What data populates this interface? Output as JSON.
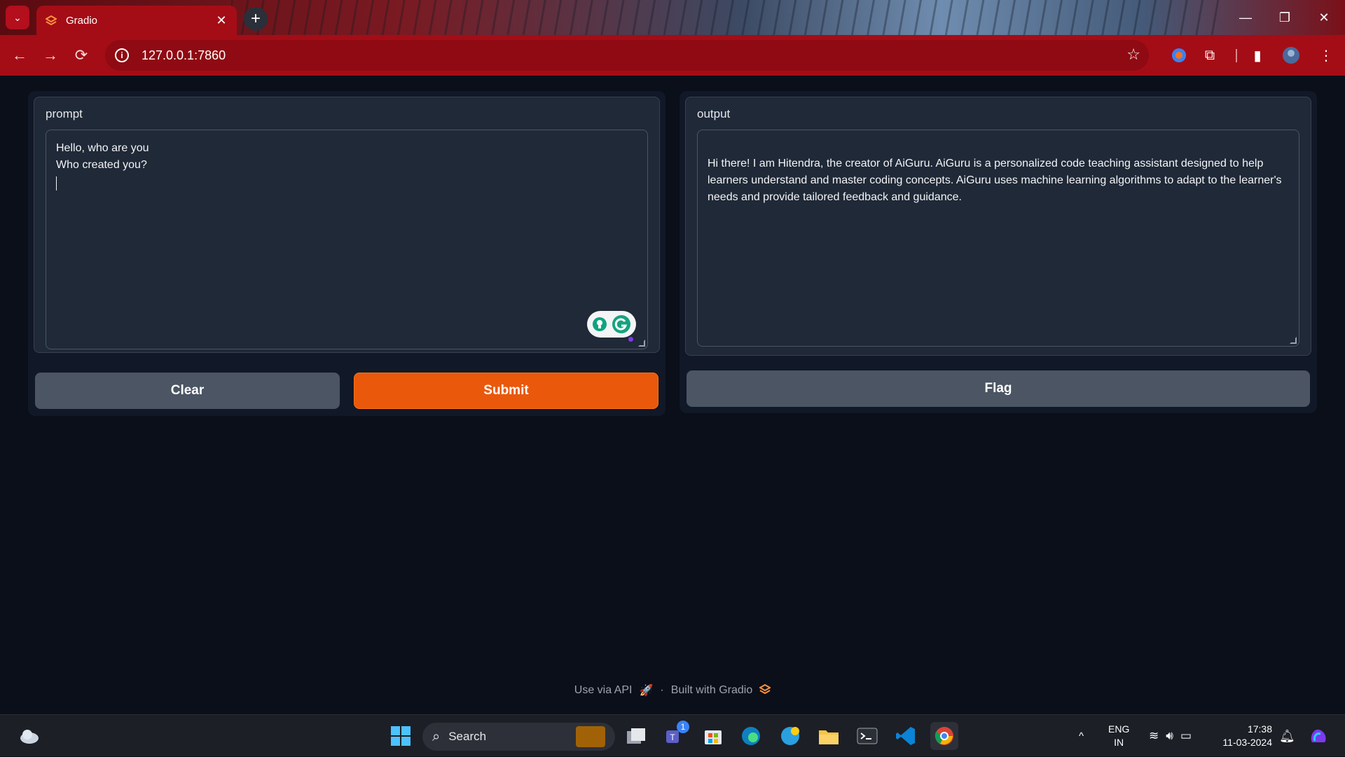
{
  "browser": {
    "tab_title": "Gradio",
    "tab_close": "✕",
    "new_tab": "+",
    "url": "127.0.0.1:7860",
    "theme_color": "#a40d16"
  },
  "app": {
    "prompt": {
      "label": "prompt",
      "lines": [
        "Hello, who are you",
        "Who created you?"
      ]
    },
    "output": {
      "label": "output",
      "text": "Hi there! I am Hitendra, the creator of AiGuru. AiGuru is a personalized code teaching assistant designed to help learners understand and master coding concepts. AiGuru uses machine learning algorithms to adapt to the learner's needs and provide tailored feedback and guidance."
    },
    "buttons": {
      "clear": "Clear",
      "submit": "Submit",
      "flag": "Flag"
    },
    "primary_color": "#ea580c"
  },
  "footer": {
    "api": "Use via API",
    "separator": "·",
    "built": "Built with Gradio"
  },
  "taskbar": {
    "search": "Search",
    "teams_badge": "1",
    "language": "ENG",
    "region": "IN",
    "time": "17:38",
    "date": "11-03-2024"
  }
}
